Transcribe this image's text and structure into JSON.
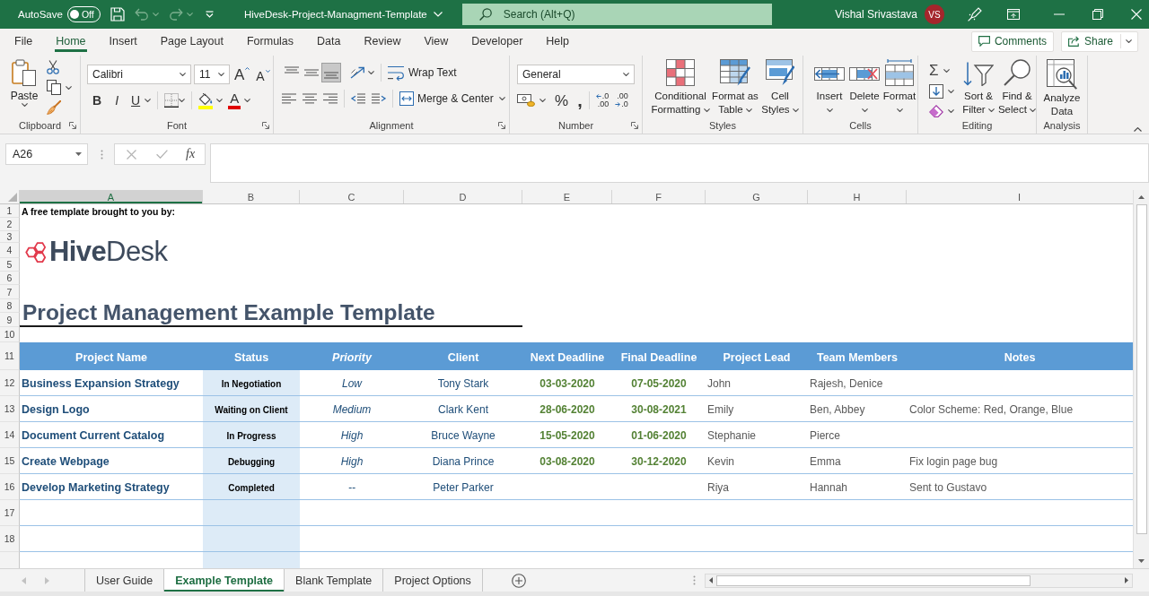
{
  "title_bar": {
    "autosave": {
      "label": "AutoSave",
      "toggle_text": "Off",
      "on": false
    },
    "quick_access": [
      {
        "kind": "save",
        "disabled": false
      },
      {
        "kind": "undo",
        "disabled": true
      },
      {
        "kind": "redo",
        "disabled": true
      },
      {
        "kind": "customize",
        "disabled": false
      }
    ],
    "document_title": "HiveDesk-Project-Managment-Template",
    "search": {
      "placeholder": "Search (Alt+Q)"
    },
    "user": {
      "name": "Vishal Srivastava",
      "initials": "VS"
    }
  },
  "menu": {
    "tabs": [
      {
        "label": "File",
        "selected": false
      },
      {
        "label": "Home",
        "selected": true
      },
      {
        "label": "Insert",
        "selected": false
      },
      {
        "label": "Page Layout",
        "selected": false
      },
      {
        "label": "Formulas",
        "selected": false
      },
      {
        "label": "Data",
        "selected": false
      },
      {
        "label": "Review",
        "selected": false
      },
      {
        "label": "View",
        "selected": false
      },
      {
        "label": "Developer",
        "selected": false
      },
      {
        "label": "Help",
        "selected": false
      }
    ],
    "comments_button": "Comments",
    "share_button": "Share"
  },
  "ribbon": {
    "groups": [
      {
        "kind": "clipboard",
        "label": "Clipboard",
        "launcher": true,
        "paste": "Paste"
      },
      {
        "kind": "font",
        "label": "Font",
        "launcher": true,
        "font_name": "Calibri",
        "font_size": "11",
        "grow_glyph": "A",
        "shrink_glyph": "A",
        "bold_glyph": "B",
        "italic_glyph": "I",
        "underline_glyph": "U",
        "font_color_glyph": "A"
      },
      {
        "kind": "alignment",
        "label": "Alignment",
        "launcher": true,
        "vertical_align": [
          {
            "kind": "top",
            "selected": false
          },
          {
            "kind": "middle",
            "selected": false
          },
          {
            "kind": "bottom",
            "selected": true
          }
        ],
        "wrap_text": "Wrap Text",
        "merge_center": "Merge & Center"
      },
      {
        "kind": "number",
        "label": "Number",
        "launcher": true,
        "format": "General",
        "percent_glyph": "%",
        "comma_glyph": ",",
        "decimal_buttons": [
          {
            "kind": "increase",
            "upper": ".0",
            "lower": ".00"
          },
          {
            "kind": "decrease",
            "upper": ".00",
            "lower": ".0"
          }
        ]
      },
      {
        "kind": "styles",
        "label": "Styles",
        "launcher": false,
        "buttons": [
          {
            "kind": "conditional",
            "label": "Conditional Formatting"
          },
          {
            "kind": "table",
            "label": "Format as Table"
          },
          {
            "kind": "cell_styles",
            "label": "Cell Styles"
          }
        ]
      },
      {
        "kind": "cells",
        "label": "Cells",
        "launcher": false,
        "buttons": [
          {
            "kind": "insert",
            "label": "Insert"
          },
          {
            "kind": "delete",
            "label": "Delete"
          },
          {
            "kind": "format",
            "label": "Format"
          }
        ]
      },
      {
        "kind": "editing",
        "label": "Editing",
        "launcher": false,
        "autosum_glyph": "Σ",
        "buttons": [
          {
            "kind": "sort",
            "label": "Sort & Filter"
          },
          {
            "kind": "find",
            "label": "Find & Select"
          }
        ]
      },
      {
        "kind": "analysis",
        "label": "Analysis",
        "launcher": false,
        "buttons": [
          {
            "kind": "analyze",
            "label": "Analyze Data"
          }
        ]
      }
    ]
  },
  "formula_bar": {
    "name_box": "A26",
    "buttons": [
      {
        "kind": "cancel",
        "disabled": true
      },
      {
        "kind": "enter",
        "disabled": true
      },
      {
        "kind": "function",
        "glyph": "fx",
        "disabled": false
      }
    ]
  },
  "sheet": {
    "column_headers": [
      {
        "letter": "A",
        "selected": true
      },
      {
        "letter": "B",
        "selected": false
      },
      {
        "letter": "C",
        "selected": false
      },
      {
        "letter": "D",
        "selected": false
      },
      {
        "letter": "E",
        "selected": false
      },
      {
        "letter": "F",
        "selected": false
      },
      {
        "letter": "G",
        "selected": false
      },
      {
        "letter": "H",
        "selected": false
      },
      {
        "letter": "I",
        "selected": false
      }
    ],
    "row_numbers": [
      "1",
      "2",
      "3",
      "4",
      "5",
      "6",
      "7",
      "8",
      "9",
      "10",
      "11",
      "12",
      "13",
      "14",
      "15",
      "16",
      "17",
      "18"
    ],
    "intro": "A free template brought to you by:",
    "logo": "**Hive**Desk",
    "title": "Project Management Example Template",
    "table": {
      "columns": [
        {
          "label": "Project Name",
          "kind": "name"
        },
        {
          "label": "Status",
          "kind": "status"
        },
        {
          "label": "Priority",
          "kind": "priority"
        },
        {
          "label": "Client",
          "kind": "client"
        },
        {
          "label": "Next Deadline",
          "kind": "date"
        },
        {
          "label": "Final Deadline",
          "kind": "date"
        },
        {
          "label": "Project Lead",
          "kind": "person"
        },
        {
          "label": "Team Members",
          "kind": "person"
        },
        {
          "label": "Notes",
          "kind": "note"
        }
      ],
      "rows": [
        [
          "Business Expansion Strategy",
          "In Negotiation",
          "Low",
          "Tony Stark",
          "03-03-2020",
          "07-05-2020",
          "John",
          "Rajesh, Denice",
          null
        ],
        [
          "Design Logo",
          "Waiting on Client",
          "Medium",
          "Clark Kent",
          "28-06-2020",
          "30-08-2021",
          "Emily",
          "Ben, Abbey",
          "Color Scheme: Red, Orange, Blue"
        ],
        [
          "Document Current Catalog",
          "In Progress",
          "High",
          "Bruce Wayne",
          "15-05-2020",
          "01-06-2020",
          "Stephanie",
          "Pierce",
          null
        ],
        [
          "Create Webpage",
          "Debugging",
          "High",
          "Diana Prince",
          "03-08-2020",
          "30-12-2020",
          "Kevin",
          "Emma",
          "Fix login page bug"
        ],
        [
          "Develop Marketing Strategy",
          "Completed",
          "--",
          "Peter Parker",
          null,
          null,
          "Riya",
          "Hannah",
          "Sent to Gustavo"
        ]
      ]
    }
  },
  "sheet_tabs": {
    "navigation": [
      {
        "kind": "previous",
        "disabled": true
      },
      {
        "kind": "next",
        "disabled": true
      }
    ],
    "tabs": [
      {
        "label": "User Guide",
        "selected": false
      },
      {
        "label": "Example Template",
        "selected": true
      },
      {
        "label": "Blank Template",
        "selected": false
      },
      {
        "label": "Project Options",
        "selected": false
      }
    ]
  }
}
